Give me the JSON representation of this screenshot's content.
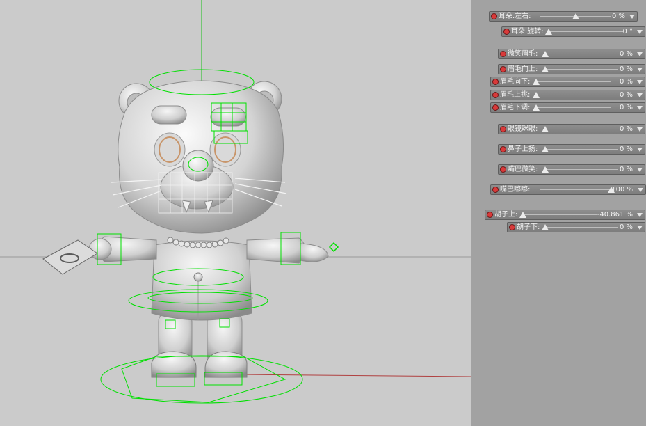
{
  "sliders": [
    {
      "label": "耳朵.左右:",
      "value": "0 %",
      "fill": 0.5
    },
    {
      "label": "耳朵.旋转:",
      "value": "0 °",
      "fill": 0.0
    },
    {
      "label": "微笑眉毛:",
      "value": "0 %",
      "fill": 0.0
    },
    {
      "label": "眉毛向上:",
      "value": "0 %",
      "fill": 0.0
    },
    {
      "label": "眉毛向下:",
      "value": "0 %",
      "fill": 0.0
    },
    {
      "label": "眉毛上挑:",
      "value": "0 %",
      "fill": 0.0
    },
    {
      "label": "眉毛下调:",
      "value": "0 %",
      "fill": 0.0
    },
    {
      "label": "眼镜眯眼:",
      "value": "0 %",
      "fill": 0.0
    },
    {
      "label": "鼻子上扬:",
      "value": "0 %",
      "fill": 0.0
    },
    {
      "label": "嘴巴微笑:",
      "value": "0 %",
      "fill": 0.0
    },
    {
      "label": "嘴巴嘟嘟:",
      "value": "100 %",
      "fill": 1.0
    },
    {
      "label": "胡子上:",
      "value": "-40.861 %",
      "fill": 0.0
    },
    {
      "label": "胡子下:",
      "value": "0 %",
      "fill": 0.0
    }
  ],
  "colors": {
    "panel_bg": "#a2a2a2",
    "viewport_bg": "#cbcbcb",
    "control_green": "#00e000",
    "keyframe_red": "#d83a3a"
  },
  "icons": {
    "slider_dot": "red-circle-icon",
    "slider_dropdown": "triangle-down-icon",
    "slider_thumb": "triangle-up-icon"
  }
}
